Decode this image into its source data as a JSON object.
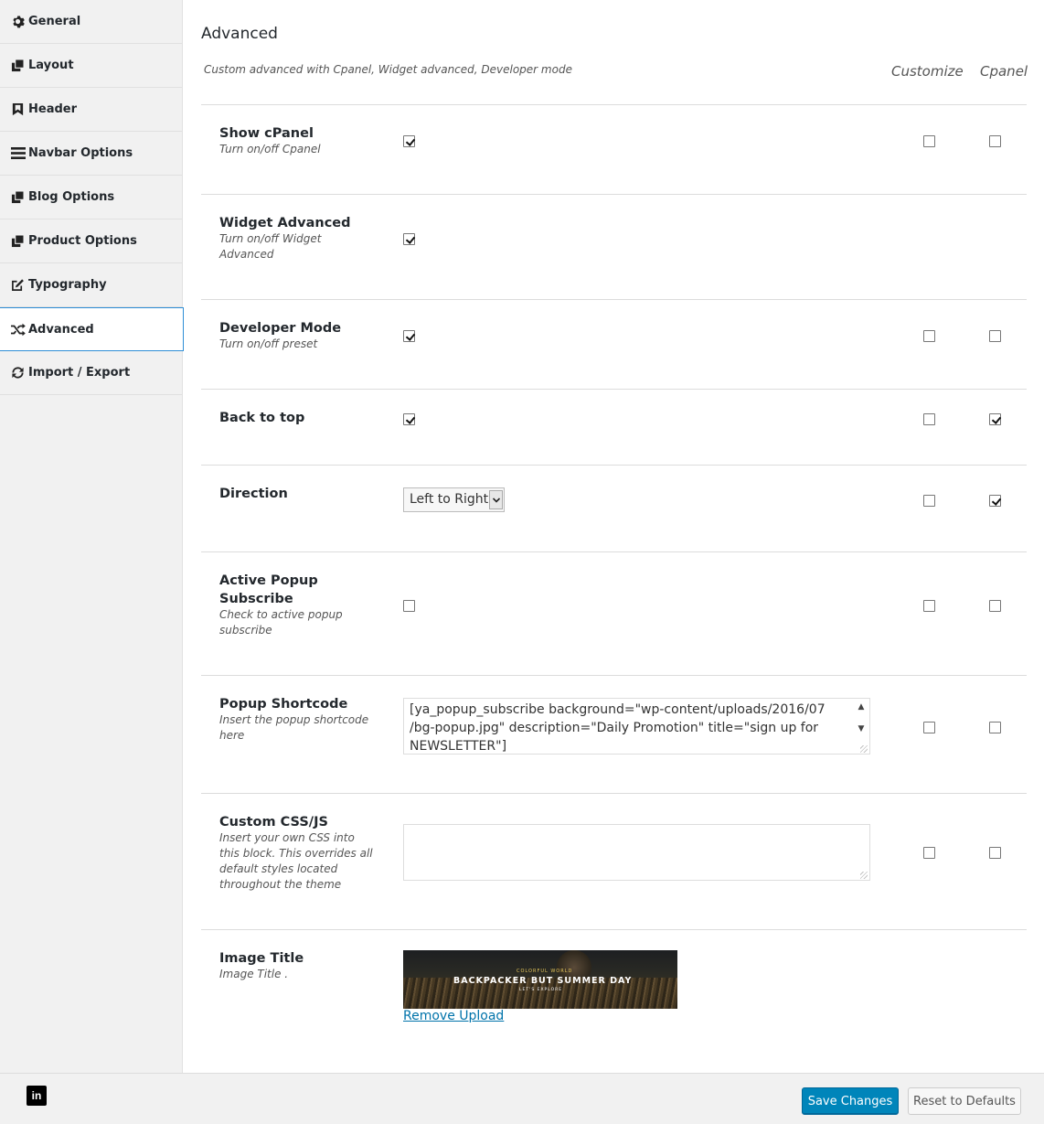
{
  "sidebar": {
    "items": [
      {
        "label": "General",
        "icon": "gear-icon"
      },
      {
        "label": "Layout",
        "icon": "copy-icon"
      },
      {
        "label": "Header",
        "icon": "bookmark-icon"
      },
      {
        "label": "Navbar Options",
        "icon": "bars-icon"
      },
      {
        "label": "Blog Options",
        "icon": "copy-icon"
      },
      {
        "label": "Product Options",
        "icon": "copy-icon"
      },
      {
        "label": "Typography",
        "icon": "edit-icon"
      },
      {
        "label": "Advanced",
        "icon": "random-icon",
        "active": true
      },
      {
        "label": "Import / Export",
        "icon": "refresh-icon"
      }
    ]
  },
  "main": {
    "title": "Advanced",
    "description": "Custom advanced with Cpanel, Widget advanced, Developer mode",
    "columns": {
      "customize": "Customize",
      "cpanel": "Cpanel"
    },
    "rows": {
      "show_cpanel": {
        "label": "Show cPanel",
        "sub": "Turn on/off Cpanel",
        "checked": true,
        "customize": false,
        "cpanel": false
      },
      "widget_advanced": {
        "label": "Widget Advanced",
        "sub": "Turn on/off Widget Advanced",
        "checked": true
      },
      "developer_mode": {
        "label": "Developer Mode",
        "sub": "Turn on/off preset",
        "checked": true,
        "customize": false,
        "cpanel": false
      },
      "back_to_top": {
        "label": "Back to top",
        "checked": true,
        "customize": false,
        "cpanel": true
      },
      "direction": {
        "label": "Direction",
        "value": "Left to Right",
        "customize": false,
        "cpanel": true
      },
      "active_popup": {
        "label": "Active Popup Subscribe",
        "sub": "Check to active popup subscribe",
        "checked": false,
        "customize": false,
        "cpanel": false
      },
      "popup_shortcode": {
        "label": "Popup Shortcode",
        "sub": "Insert the popup shortcode here",
        "value_line1": "[ya_popup_subscribe background=\"wp-content/uploads/2016/07",
        "value_line2": "/bg-popup.jpg\" description=\"Daily Promotion\" title=\"sign up for",
        "value_line3": "NEWSLETTER\"]",
        "customize": false,
        "cpanel": false
      },
      "custom_css": {
        "label": "Custom CSS/JS",
        "sub": "Insert your own CSS into this block. This overrides all default styles located throughout the theme",
        "value": "",
        "customize": false,
        "cpanel": false
      },
      "image_title": {
        "label": "Image Title",
        "sub": "Image Title .",
        "image_text_small": "COLORFUL WORLD",
        "image_text_big": "BACKPACKER BUT SUMMER DAY",
        "image_text_tiny": "LET'S EXPLORE",
        "remove_label": "Remove Upload"
      }
    }
  },
  "footer": {
    "linkedin": "in",
    "save_label": "Save Changes",
    "reset_label": "Reset to Defaults"
  },
  "colors": {
    "accent": "#0085ba",
    "active_border": "#2e8ed6",
    "link": "#0073aa"
  }
}
